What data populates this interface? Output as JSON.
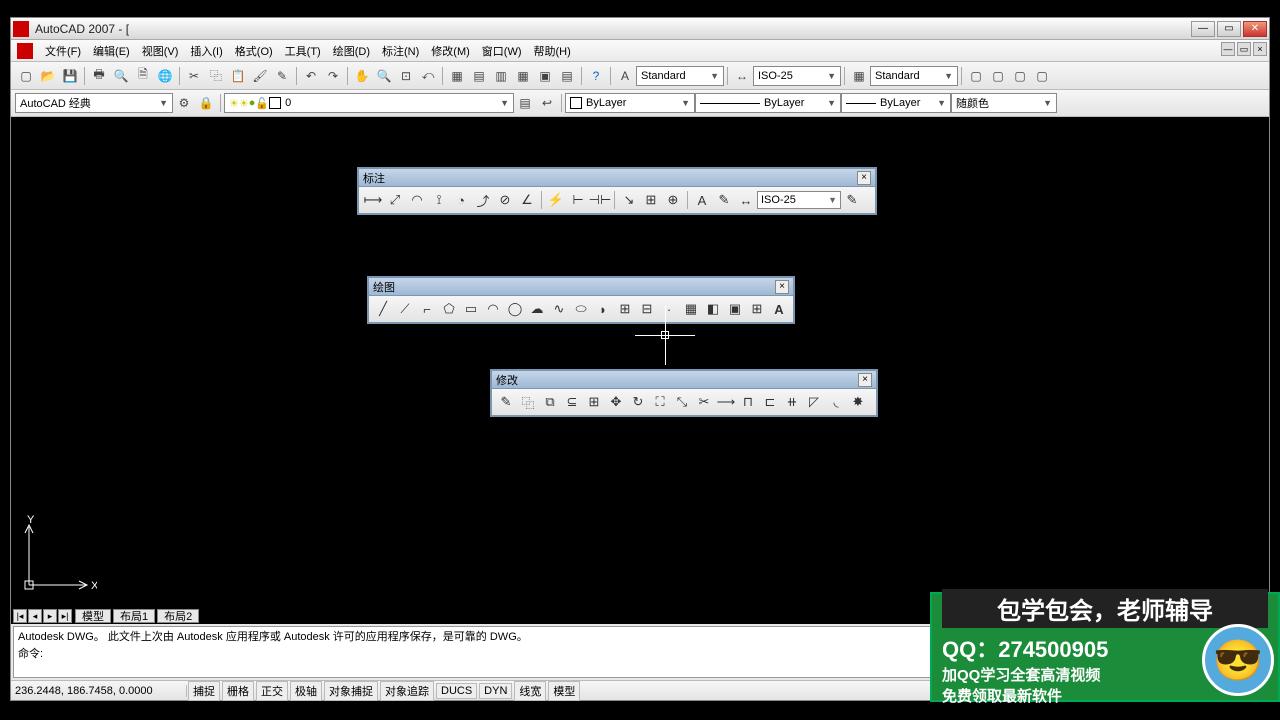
{
  "title": "AutoCAD 2007 - [",
  "menus": [
    "文件(F)",
    "编辑(E)",
    "视图(V)",
    "插入(I)",
    "格式(O)",
    "工具(T)",
    "绘图(D)",
    "标注(N)",
    "修改(M)",
    "窗口(W)",
    "帮助(H)"
  ],
  "workspace": "AutoCAD 经典",
  "layer_value": "0",
  "textstyle": "Standard",
  "dimstyle": "ISO-25",
  "tablestyle": "Standard",
  "bylayer": "ByLayer",
  "color_label": "随颜色",
  "float_dim": {
    "title": "标注",
    "dimstyle": "ISO-25"
  },
  "float_draw": {
    "title": "绘图"
  },
  "float_modify": {
    "title": "修改"
  },
  "tabs": [
    "模型",
    "布局1",
    "布局2"
  ],
  "cmd_line1": "Autodesk DWG。  此文件上次由 Autodesk 应用程序或 Autodesk 许可的应用程序保存，是可靠的 DWG。",
  "cmd_line2": "命令:",
  "coords": "236.2448, 186.7458, 0.0000",
  "status_buttons": [
    "捕捉",
    "栅格",
    "正交",
    "极轴",
    "对象捕捉",
    "对象追踪",
    "DUCS",
    "DYN",
    "线宽",
    "模型"
  ],
  "ad": {
    "line1": "包学包会，老师辅导",
    "line2": "QQ：274500905",
    "line3": "加QQ学习全套高清视频",
    "line4": "免费领取最新软件"
  }
}
